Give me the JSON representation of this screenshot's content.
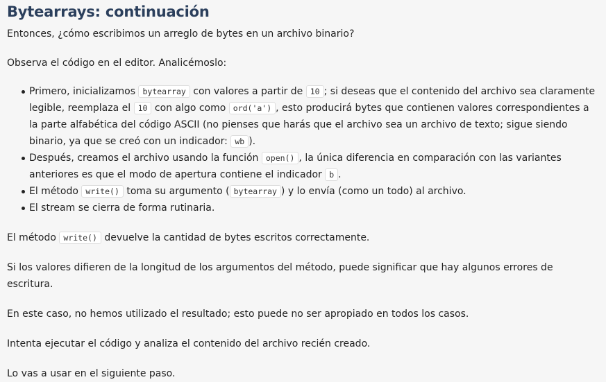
{
  "title": "Bytearrays: continuación",
  "intro": "Entonces, ¿cómo escribimos un arreglo de bytes en un archivo binario?",
  "observe": "Observa el código en el editor. Analicémoslo:",
  "list": {
    "item1": {
      "t1": "Primero, inicializamos ",
      "c1": "bytearray",
      "t2": " con valores a partir de ",
      "c2": "10",
      "t3": "; si deseas que el contenido del archivo sea claramente legible, reemplaza el ",
      "c3": "10",
      "t4": " con algo como ",
      "c4": "ord('a')",
      "t5": ", esto producirá bytes que contienen valores correspondientes a la parte alfabética del código ASCII (no pienses que harás que el archivo sea un archivo de texto; sigue siendo binario, ya que se creó con un indicador: ",
      "c5": "wb",
      "t6": ")."
    },
    "item2": {
      "t1": "Después, creamos el archivo usando la función ",
      "c1": "open()",
      "t2": ", la única diferencia en comparación con las variantes anteriores es que el modo de apertura contiene el indicador ",
      "c2": "b",
      "t3": "."
    },
    "item3": {
      "t1": "El método ",
      "c1": "write()",
      "t2": " toma su argumento (",
      "c2": "bytearray",
      "t3": ") y lo envía (como un todo) al archivo."
    },
    "item4": {
      "t1": "El stream se cierra de forma rutinaria."
    }
  },
  "p_method": {
    "t1": "El método ",
    "c1": "write()",
    "t2": " devuelve la cantidad de bytes escritos correctamente."
  },
  "p_diff": "Si los valores difieren de la longitud de los argumentos del método, puede significar que hay algunos errores de escritura.",
  "p_case": "En este caso, no hemos utilizado el resultado; esto puede no ser apropiado en todos los casos.",
  "p_try": "Intenta ejecutar el código y analiza el contenido del archivo recién creado.",
  "p_next": "Lo vas a usar en el siguiente paso."
}
